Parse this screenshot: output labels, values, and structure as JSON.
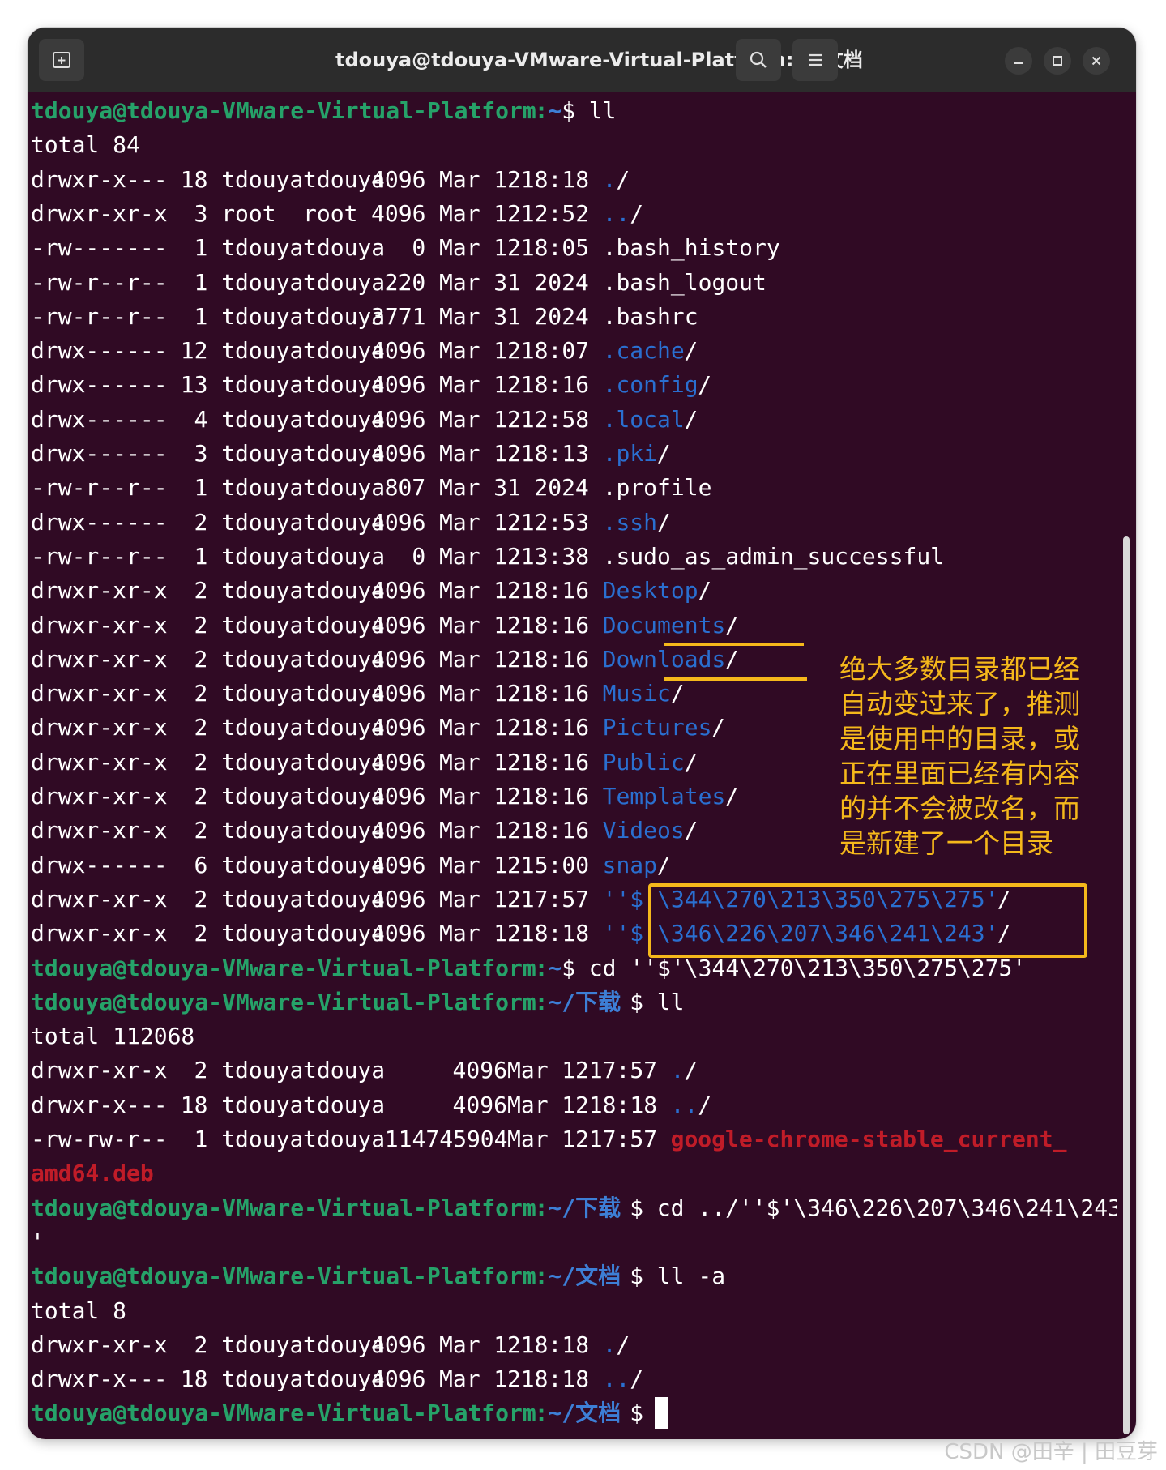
{
  "window": {
    "title": "tdouya@tdouya-VMware-Virtual-Platform: ~/文档"
  },
  "icons": {
    "new_tab": "new-tab-icon",
    "search": "search-icon",
    "menu": "hamburger-menu-icon",
    "minimize": "minimize-icon",
    "maximize": "maximize-icon",
    "close": "close-icon"
  },
  "colors": {
    "terminal_bg": "#300a24",
    "prompt_green": "#26a269",
    "dir_blue": "#2a6fd0",
    "archive_red": "#c01c28",
    "annotation_orange": "#f5b81b"
  },
  "prompt": {
    "user_host": "tdouya@tdouya-VMware-Virtual-Platform"
  },
  "listing1": {
    "command": "ll",
    "total": "total 84",
    "rows": [
      {
        "perm": "drwxr-x---",
        "links": "18",
        "owner": "tdouya",
        "group": "tdouya",
        "size": "4096",
        "month": "Mar",
        "day": "12",
        "time": "18:18",
        "name": ".",
        "suffix": "/"
      },
      {
        "perm": "drwxr-xr-x",
        "links": "3",
        "owner": "root",
        "group": "root",
        "size": "4096",
        "month": "Mar",
        "day": "12",
        "time": "12:52",
        "name": "..",
        "suffix": "/"
      },
      {
        "perm": "-rw-------",
        "links": "1",
        "owner": "tdouya",
        "group": "tdouya",
        "size": "0",
        "month": "Mar",
        "day": "12",
        "time": "18:05",
        "name": ".bash_history",
        "suffix": ""
      },
      {
        "perm": "-rw-r--r--",
        "links": "1",
        "owner": "tdouya",
        "group": "tdouya",
        "size": "220",
        "month": "Mar",
        "day": "31",
        "time": "2024",
        "name": ".bash_logout",
        "suffix": ""
      },
      {
        "perm": "-rw-r--r--",
        "links": "1",
        "owner": "tdouya",
        "group": "tdouya",
        "size": "3771",
        "month": "Mar",
        "day": "31",
        "time": "2024",
        "name": ".bashrc",
        "suffix": ""
      },
      {
        "perm": "drwx------",
        "links": "12",
        "owner": "tdouya",
        "group": "tdouya",
        "size": "4096",
        "month": "Mar",
        "day": "12",
        "time": "18:07",
        "name": ".cache",
        "suffix": "/"
      },
      {
        "perm": "drwx------",
        "links": "13",
        "owner": "tdouya",
        "group": "tdouya",
        "size": "4096",
        "month": "Mar",
        "day": "12",
        "time": "18:16",
        "name": ".config",
        "suffix": "/"
      },
      {
        "perm": "drwx------",
        "links": "4",
        "owner": "tdouya",
        "group": "tdouya",
        "size": "4096",
        "month": "Mar",
        "day": "12",
        "time": "12:58",
        "name": ".local",
        "suffix": "/"
      },
      {
        "perm": "drwx------",
        "links": "3",
        "owner": "tdouya",
        "group": "tdouya",
        "size": "4096",
        "month": "Mar",
        "day": "12",
        "time": "18:13",
        "name": ".pki",
        "suffix": "/"
      },
      {
        "perm": "-rw-r--r--",
        "links": "1",
        "owner": "tdouya",
        "group": "tdouya",
        "size": "807",
        "month": "Mar",
        "day": "31",
        "time": "2024",
        "name": ".profile",
        "suffix": ""
      },
      {
        "perm": "drwx------",
        "links": "2",
        "owner": "tdouya",
        "group": "tdouya",
        "size": "4096",
        "month": "Mar",
        "day": "12",
        "time": "12:53",
        "name": ".ssh",
        "suffix": "/"
      },
      {
        "perm": "-rw-r--r--",
        "links": "1",
        "owner": "tdouya",
        "group": "tdouya",
        "size": "0",
        "month": "Mar",
        "day": "12",
        "time": "13:38",
        "name": ".sudo_as_admin_successful",
        "suffix": ""
      },
      {
        "perm": "drwxr-xr-x",
        "links": "2",
        "owner": "tdouya",
        "group": "tdouya",
        "size": "4096",
        "month": "Mar",
        "day": "12",
        "time": "18:16",
        "name": "Desktop",
        "suffix": "/"
      },
      {
        "perm": "drwxr-xr-x",
        "links": "2",
        "owner": "tdouya",
        "group": "tdouya",
        "size": "4096",
        "month": "Mar",
        "day": "12",
        "time": "18:16",
        "name": "Documents",
        "suffix": "/"
      },
      {
        "perm": "drwxr-xr-x",
        "links": "2",
        "owner": "tdouya",
        "group": "tdouya",
        "size": "4096",
        "month": "Mar",
        "day": "12",
        "time": "18:16",
        "name": "Downloads",
        "suffix": "/"
      },
      {
        "perm": "drwxr-xr-x",
        "links": "2",
        "owner": "tdouya",
        "group": "tdouya",
        "size": "4096",
        "month": "Mar",
        "day": "12",
        "time": "18:16",
        "name": "Music",
        "suffix": "/"
      },
      {
        "perm": "drwxr-xr-x",
        "links": "2",
        "owner": "tdouya",
        "group": "tdouya",
        "size": "4096",
        "month": "Mar",
        "day": "12",
        "time": "18:16",
        "name": "Pictures",
        "suffix": "/"
      },
      {
        "perm": "drwxr-xr-x",
        "links": "2",
        "owner": "tdouya",
        "group": "tdouya",
        "size": "4096",
        "month": "Mar",
        "day": "12",
        "time": "18:16",
        "name": "Public",
        "suffix": "/"
      },
      {
        "perm": "drwxr-xr-x",
        "links": "2",
        "owner": "tdouya",
        "group": "tdouya",
        "size": "4096",
        "month": "Mar",
        "day": "12",
        "time": "18:16",
        "name": "Templates",
        "suffix": "/"
      },
      {
        "perm": "drwxr-xr-x",
        "links": "2",
        "owner": "tdouya",
        "group": "tdouya",
        "size": "4096",
        "month": "Mar",
        "day": "12",
        "time": "18:16",
        "name": "Videos",
        "suffix": "/"
      },
      {
        "perm": "drwx------",
        "links": "6",
        "owner": "tdouya",
        "group": "tdouya",
        "size": "4096",
        "month": "Mar",
        "day": "12",
        "time": "15:00",
        "name": "snap",
        "suffix": "/"
      },
      {
        "perm": "drwxr-xr-x",
        "links": "2",
        "owner": "tdouya",
        "group": "tdouya",
        "size": "4096",
        "month": "Mar",
        "day": "12",
        "time": "17:57",
        "name": "''$'\\344\\270\\213\\350\\275\\275'",
        "suffix": "/"
      },
      {
        "perm": "drwxr-xr-x",
        "links": "2",
        "owner": "tdouya",
        "group": "tdouya",
        "size": "4096",
        "month": "Mar",
        "day": "12",
        "time": "18:18",
        "name": "''$'\\346\\226\\207\\346\\241\\243'",
        "suffix": "/"
      }
    ]
  },
  "cd1": {
    "path": "~",
    "command": "cd ''$'\\344\\270\\213\\350\\275\\275'"
  },
  "ll2": {
    "path": "~/下载",
    "command": "ll",
    "total": "total 112068",
    "rows": [
      {
        "perm": "drwxr-xr-x",
        "links": "2",
        "owner": "tdouya",
        "group": "tdouya",
        "size": "4096",
        "month": "Mar",
        "day": "12",
        "time": "17:57",
        "name": ".",
        "suffix": "/"
      },
      {
        "perm": "drwxr-x---",
        "links": "18",
        "owner": "tdouya",
        "group": "tdouya",
        "size": "4096",
        "month": "Mar",
        "day": "12",
        "time": "18:18",
        "name": "..",
        "suffix": "/"
      },
      {
        "perm": "-rw-rw-r--",
        "links": "1",
        "owner": "tdouya",
        "group": "tdouya",
        "size": "114745904",
        "month": "Mar",
        "day": "12",
        "time": "17:57",
        "name": "google-chrome-stable_current_",
        "suffix": ""
      }
    ],
    "wrap": "amd64.deb"
  },
  "cd2": {
    "path": "~/下载",
    "command": "cd ../''$'\\346\\226\\207\\346\\241\\243",
    "wrap": "'"
  },
  "ll3": {
    "path": "~/文档",
    "command": "ll -a",
    "total": "total 8",
    "rows": [
      {
        "perm": "drwxr-xr-x",
        "links": "2",
        "owner": "tdouya",
        "group": "tdouya",
        "size": "4096",
        "month": "Mar",
        "day": "12",
        "time": "18:18",
        "name": ".",
        "suffix": "/"
      },
      {
        "perm": "drwxr-x---",
        "links": "18",
        "owner": "tdouya",
        "group": "tdouya",
        "size": "4096",
        "month": "Mar",
        "day": "12",
        "time": "18:18",
        "name": "..",
        "suffix": "/"
      }
    ]
  },
  "final_prompt": {
    "path": "~/文档"
  },
  "annotation": {
    "lines": [
      "绝大多数目录都已经",
      "自动变过来了，推测",
      "是使用中的目录，或",
      "正在里面已经有内容",
      "的并不会被改名，而",
      "是新建了一个目录"
    ]
  },
  "watermark": "CSDN @田辛 | 田豆芽"
}
